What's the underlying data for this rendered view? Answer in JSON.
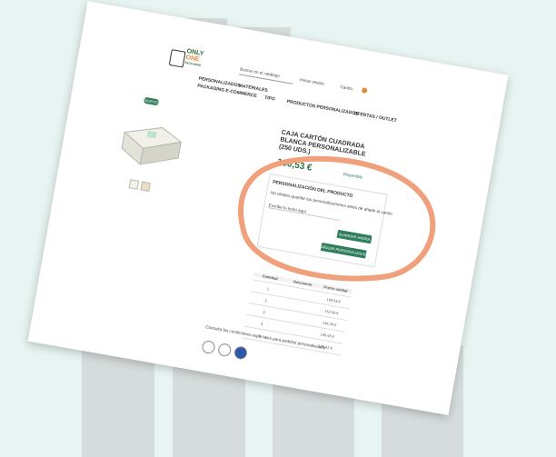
{
  "logo": {
    "line1": "ONLY",
    "line2": "ONE",
    "line3": "PACKAGING"
  },
  "search": {
    "placeholder": "Buscar en el catálogo"
  },
  "header": {
    "account": "Iniciar sesión",
    "cart": "Carrito"
  },
  "nav": {
    "items": [
      "PERSONALIZADOS",
      "MATERIALES",
      "PACKAGING E-COMMERCE",
      "TIPO",
      "PRODUCTOS PERSONALIZADOS",
      "OFERTAS / OUTLET"
    ]
  },
  "tag": "NUEVO",
  "product": {
    "title": "CAJA CARTÓN CUADRADA BLANCA PERSONALIZABLE (250 UDS.)",
    "price": "160,53 €",
    "stock": "Disponible",
    "personalization_title": "PERSONALIZACIÓN DEL PRODUCTO",
    "personalization_text": "No olvides guardar tus personalizaciones antes de añadir al carrito",
    "field_placeholder": "Escribe tu texto aquí",
    "save_button": "GUARDAR AHORA",
    "add_button": "AÑADIR PERSONALIZACIÓN"
  },
  "table": {
    "headers": [
      "Cantidad",
      "Descuento",
      "Precio unidad"
    ],
    "rows": [
      [
        "1",
        "",
        "160,53 €"
      ],
      [
        "2",
        "",
        "152,50 €"
      ],
      [
        "3",
        "",
        "144,48 €"
      ],
      [
        "4",
        "",
        "136,45 €"
      ],
      [
        "5",
        "",
        "128,42 €"
      ]
    ]
  },
  "footer_text": "Consulta las condiciones especiales para pedidos personalizados",
  "footer_icons": [
    "wheel-icon",
    "box-icon",
    "shirt-icon"
  ]
}
